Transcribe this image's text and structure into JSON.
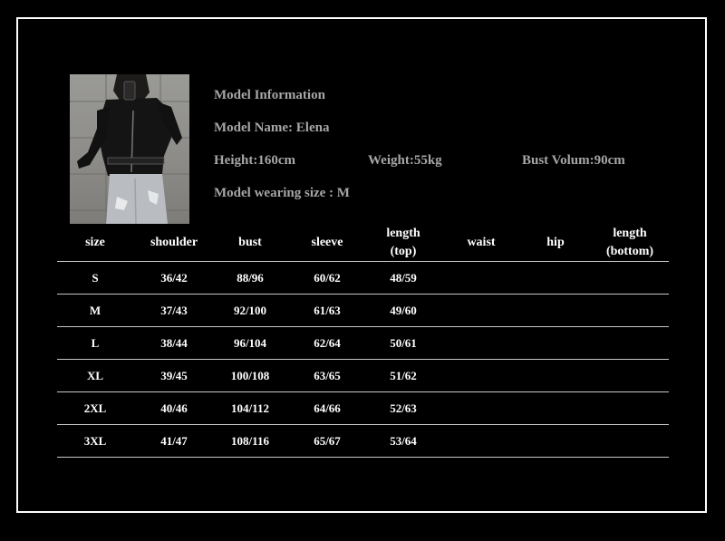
{
  "model": {
    "heading": "Model Information",
    "name": "Model Name: Elena",
    "height": "Height:160cm",
    "weight": "Weight:55kg",
    "bust": "Bust Volum:90cm",
    "size": "Model wearing size : M"
  },
  "table": {
    "headers": {
      "size": "size",
      "shoulder": "shoulder",
      "bust": "bust",
      "sleeve": "sleeve",
      "length_top_1": "length",
      "length_top_2": "(top)",
      "waist": "waist",
      "hip": "hip",
      "length_bottom_1": "length",
      "length_bottom_2": "(bottom)"
    },
    "rows": [
      {
        "size": "S",
        "shoulder": "36/42",
        "bust": "88/96",
        "sleeve": "60/62",
        "length_top": "48/59"
      },
      {
        "size": "M",
        "shoulder": "37/43",
        "bust": "92/100",
        "sleeve": "61/63",
        "length_top": "49/60"
      },
      {
        "size": "L",
        "shoulder": "38/44",
        "bust": "96/104",
        "sleeve": "62/64",
        "length_top": "50/61"
      },
      {
        "size": "XL",
        "shoulder": "39/45",
        "bust": "100/108",
        "sleeve": "63/65",
        "length_top": "51/62"
      },
      {
        "size": "2XL",
        "shoulder": "40/46",
        "bust": "104/112",
        "sleeve": "64/66",
        "length_top": "52/63"
      },
      {
        "size": "3XL",
        "shoulder": "41/47",
        "bust": "108/116",
        "sleeve": "65/67",
        "length_top": "53/64"
      }
    ]
  }
}
